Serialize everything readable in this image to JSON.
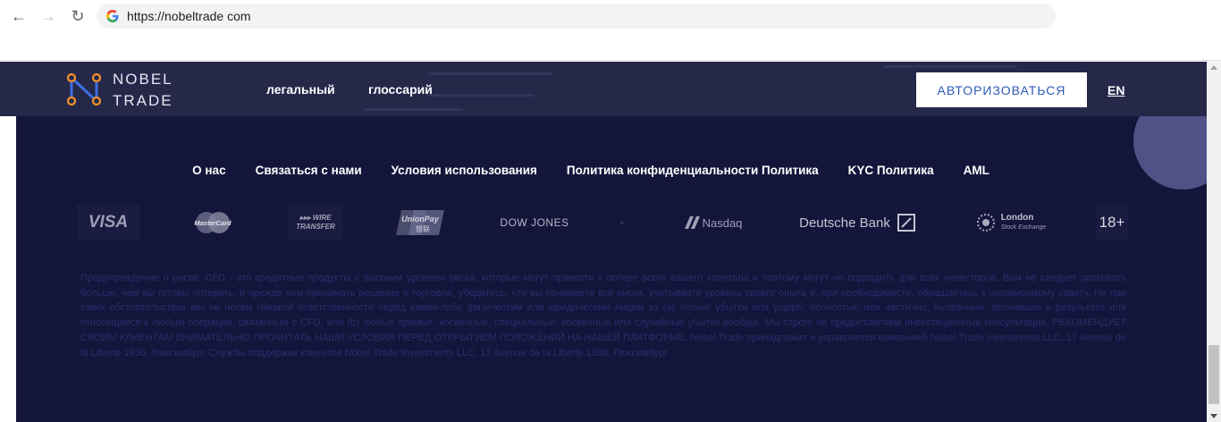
{
  "browser": {
    "url": "https://nobeltrade com",
    "icons": {
      "back": "arrow-left-icon",
      "forward": "arrow-right-icon",
      "reload": "reload-icon",
      "site": "google-icon"
    }
  },
  "header": {
    "logo": {
      "line1": "NOBEL",
      "line2": "TRADE"
    },
    "nav": [
      "легальный",
      "глоссарий"
    ],
    "auth_label": "АВТОРИЗОВАТЬСЯ",
    "lang": "EN"
  },
  "footer_nav": [
    "О нас",
    "Связаться с нами",
    "Условия использования",
    "Политика конфиденциальности Политика",
    "KYC Политика",
    "AML"
  ],
  "partners": {
    "visa": "VISA",
    "mastercard": "MasterCard",
    "wire_line1": "▸▸▸ WIRE",
    "wire_line2": "TRANSFER",
    "unionpay_line1": "UnionPay",
    "unionpay_line2": "银联",
    "dowjones": "DOW JONES",
    "plus": "+",
    "nasdaq": "Nasdaq",
    "deutsche_bank": "Deutsche Bank",
    "lse_line1": "London",
    "lse_line2": "Stock Exchange",
    "age": "18+"
  },
  "disclaimer": "Предупреждение о риске: CFD - это кредитные продукты с высоким уровнем риска, которые могут привести к потере всего вашего капитала и поэтому могут не подходить для всех инвесторов. Вам не следует рисковать больше, чем вы готовы потерять, и прежде чем принимать решение о торговле, убедитесь, что вы понимаете все риски, учитываете уровень своего опыта и, при необходимости, обращаетесь к независимому совету. Ни при каких обстоятельствах мы не несем никакой ответственности перед каким-либо физическим или юридическим лицом за (a) любые убытки или ущерб, полностью или частично, вызванные, возникшие в результате или относящиеся к любым операции, связанным с CFD, или (b) любые прямые, косвенные, специальные, косвенные или случайные убытки вообще. Мы строго не предоставляем инвестиционные консультации. РЕКОМЕНДУЕТ СВОИМ КЛИЕНТАМ ВНИМАТЕЛЬНО ПРОЧИТАТЬ НАШИ УСЛОВИЯ ПЕРЕД ОТКРЫТИЕМ ПОЛОЖЕНИЙ НА НАШЕЙ ПЛАТФОРМЕ. Nobel Trade принадлежит и управляется компанией Nobel Trade Investments LLC, 17 Avenue de la Liberte 1930, Люксембург Службы поддержки клиентов Nobel Trade Investments LLC, 17 Avenue de la Liberte 1930, Люксембург",
  "colors": {
    "page_bg": "#14153b",
    "header_bg": "#26284a",
    "auth_text": "#2e5ab8",
    "logo_accent": "#f0922b",
    "logo_blue": "#3c6fe0",
    "disclaimer_text": "#2a2d6a"
  }
}
